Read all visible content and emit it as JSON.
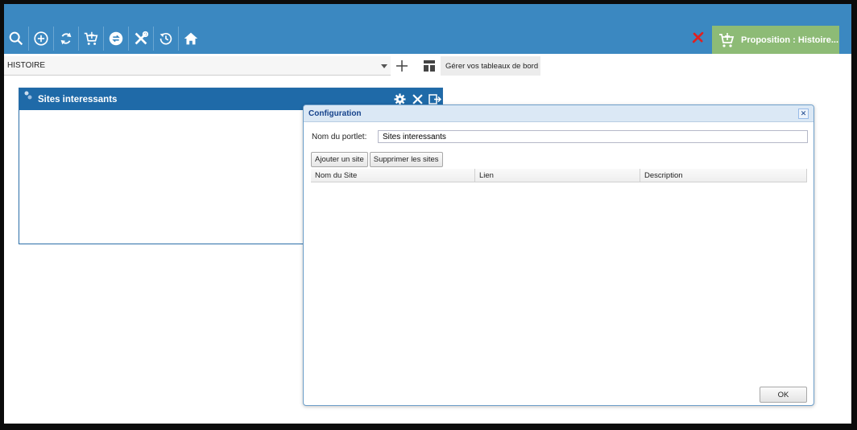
{
  "toolbar": {
    "icons": [
      "search-icon",
      "add-circle-icon",
      "refresh-icon",
      "cart-icon",
      "swap-icon",
      "tools-icon",
      "history-icon",
      "home-icon"
    ]
  },
  "proposition": {
    "label": "Proposition : Histoire..."
  },
  "dashboard": {
    "selected": "HISTOIRE",
    "manage_label": "Gérer vos tableaux de bord"
  },
  "portlet": {
    "title": "Sites interessants"
  },
  "dialog": {
    "title": "Configuration",
    "name_label": "Nom du portlet:",
    "name_value": "Sites interessants",
    "add_site": "Ajouter un site",
    "remove_sites": "Supprimer les sites",
    "columns": [
      "Nom du Site",
      "Lien",
      "Description"
    ],
    "ok": "OK"
  },
  "colors": {
    "appbar": "#3b88c1",
    "proposition": "#8dbb76",
    "portlet_header": "#1f6aa8",
    "cancel": "#e02020"
  }
}
